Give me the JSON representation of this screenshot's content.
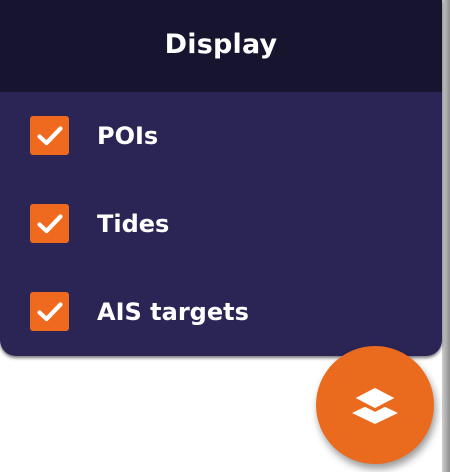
{
  "panel": {
    "title": "Display",
    "options": [
      {
        "label": "POIs",
        "checked": true
      },
      {
        "label": "Tides",
        "checked": true
      },
      {
        "label": "AIS targets",
        "checked": true
      }
    ]
  },
  "fab": {
    "icon": "layers-icon"
  },
  "colors": {
    "panel_background": "#2b2556",
    "header_background": "#16142f",
    "accent": "#ef6a1e",
    "text": "#ffffff"
  }
}
